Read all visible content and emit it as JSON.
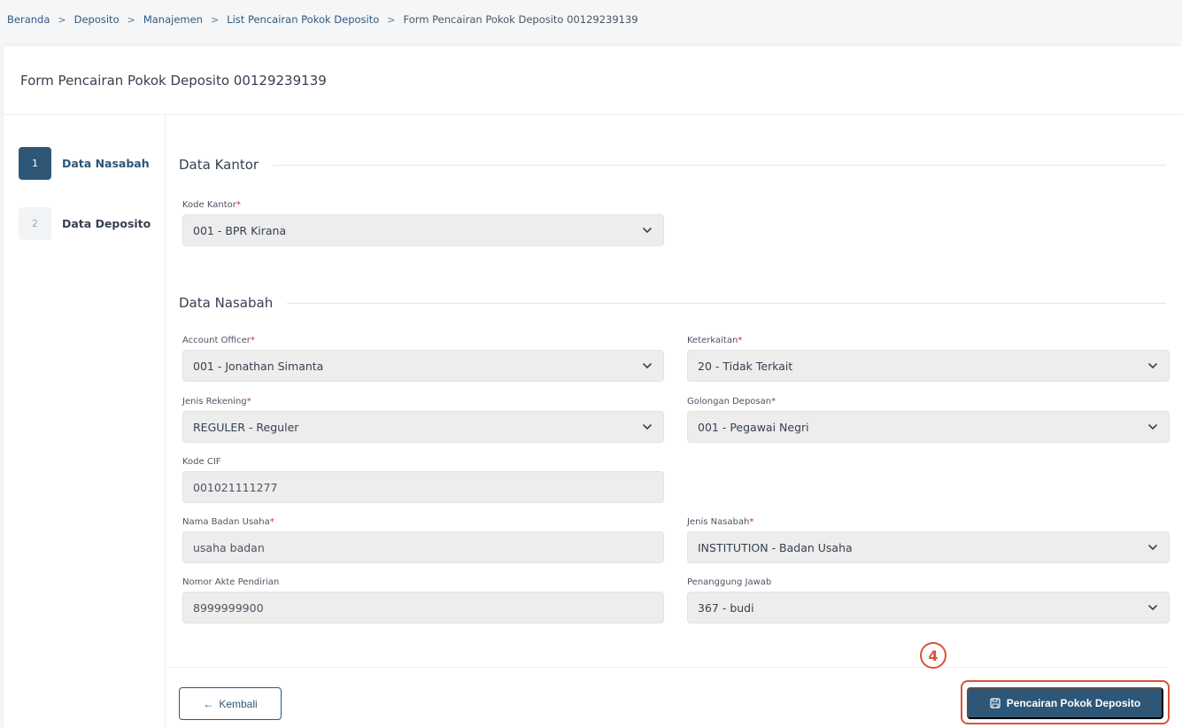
{
  "breadcrumb": {
    "items": [
      "Beranda",
      "Deposito",
      "Manajemen",
      "List Pencairan Pokok Deposito"
    ],
    "current": "Form Pencairan Pokok Deposito 00129239139",
    "separator": ">"
  },
  "page": {
    "title": "Form Pencairan Pokok Deposito 00129239139"
  },
  "steps": [
    {
      "number": "1",
      "label": "Data Nasabah",
      "active": true
    },
    {
      "number": "2",
      "label": "Data Deposito",
      "active": false
    }
  ],
  "sections": {
    "kantor": "Data Kantor",
    "nasabah": "Data Nasabah"
  },
  "fields": {
    "kode_kantor": {
      "label": "Kode Kantor",
      "required": "*",
      "value": "001 - BPR Kirana"
    },
    "account_officer": {
      "label": "Account Officer",
      "required": "*",
      "value": "001 - Jonathan Simanta"
    },
    "keterkaitan": {
      "label": "Keterkaitan",
      "required": "*",
      "value": "20 - Tidak Terkait"
    },
    "jenis_rekening": {
      "label": "Jenis Rekening",
      "required": "*",
      "value": "REGULER - Reguler"
    },
    "golongan_deposan": {
      "label": "Golongan Deposan",
      "required": "*",
      "value": "001 - Pegawai Negri"
    },
    "kode_cif": {
      "label": "Kode CIF",
      "value": "001021111277"
    },
    "nama_badan_usaha": {
      "label": "Nama Badan Usaha",
      "required": "*",
      "value": "usaha badan"
    },
    "jenis_nasabah": {
      "label": "Jenis Nasabah",
      "required": "*",
      "value": "INSTITUTION - Badan Usaha"
    },
    "nomor_akte": {
      "label": "Nomor Akte Pendirian",
      "value": "8999999900"
    },
    "penanggung_jawab": {
      "label": "Penanggung Jawab",
      "value": "367 - budi"
    }
  },
  "actions": {
    "back_arrow": "←",
    "back_label": "Kembali",
    "submit_label": "Pencairan Pokok Deposito",
    "callout_number": "4"
  },
  "colors": {
    "primary": "#2d5677",
    "highlight": "#d9523b",
    "required": "#e11d48"
  },
  "icons": {
    "dropdown": "chevron-down-icon",
    "save": "save-icon"
  }
}
